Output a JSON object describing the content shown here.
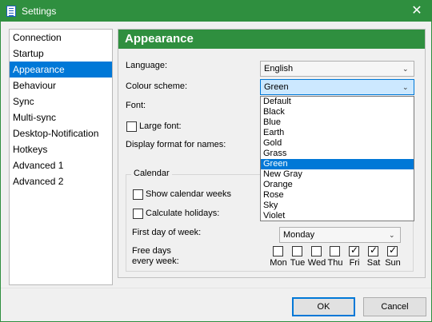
{
  "window": {
    "title": "Settings",
    "close": "✕"
  },
  "sidebar": {
    "items": [
      {
        "label": "Connection",
        "selected": false
      },
      {
        "label": "Startup",
        "selected": false
      },
      {
        "label": "Appearance",
        "selected": true
      },
      {
        "label": "Behaviour",
        "selected": false
      },
      {
        "label": "Sync",
        "selected": false
      },
      {
        "label": "Multi-sync",
        "selected": false
      },
      {
        "label": "Desktop-Notification",
        "selected": false
      },
      {
        "label": "Hotkeys",
        "selected": false
      },
      {
        "label": "Advanced 1",
        "selected": false
      },
      {
        "label": "Advanced 2",
        "selected": false
      }
    ]
  },
  "panel": {
    "title": "Appearance",
    "language_label": "Language:",
    "language_value": "English",
    "colour_label": "Colour scheme:",
    "colour_value": "Green",
    "font_label": "Font:",
    "large_font_label": "Large font:",
    "display_format_label": "Display format for names:",
    "colour_options": [
      "Default",
      "Black",
      "Blue",
      "Earth",
      "Gold",
      "Grass",
      "Green",
      "New Gray",
      "Orange",
      "Rose",
      "Sky",
      "Violet"
    ],
    "colour_selected": "Green"
  },
  "calendar": {
    "group_label": "Calendar",
    "show_weeks_label": "Show calendar weeks",
    "calc_holidays_label": "Calculate holidays:",
    "first_day_label": "First day of week:",
    "first_day_value": "Monday",
    "free_days_label_line1": "Free days",
    "free_days_label_line2": "every week:",
    "days": [
      {
        "label": "Mon",
        "checked": false
      },
      {
        "label": "Tue",
        "checked": false
      },
      {
        "label": "Wed",
        "checked": false
      },
      {
        "label": "Thu",
        "checked": false
      },
      {
        "label": "Fri",
        "checked": true
      },
      {
        "label": "Sat",
        "checked": true
      },
      {
        "label": "Sun",
        "checked": true
      }
    ]
  },
  "footer": {
    "ok_label": "OK",
    "cancel_label": "Cancel"
  },
  "colors": {
    "accent_green": "#2f8f3f",
    "selection_blue": "#0078d7"
  }
}
